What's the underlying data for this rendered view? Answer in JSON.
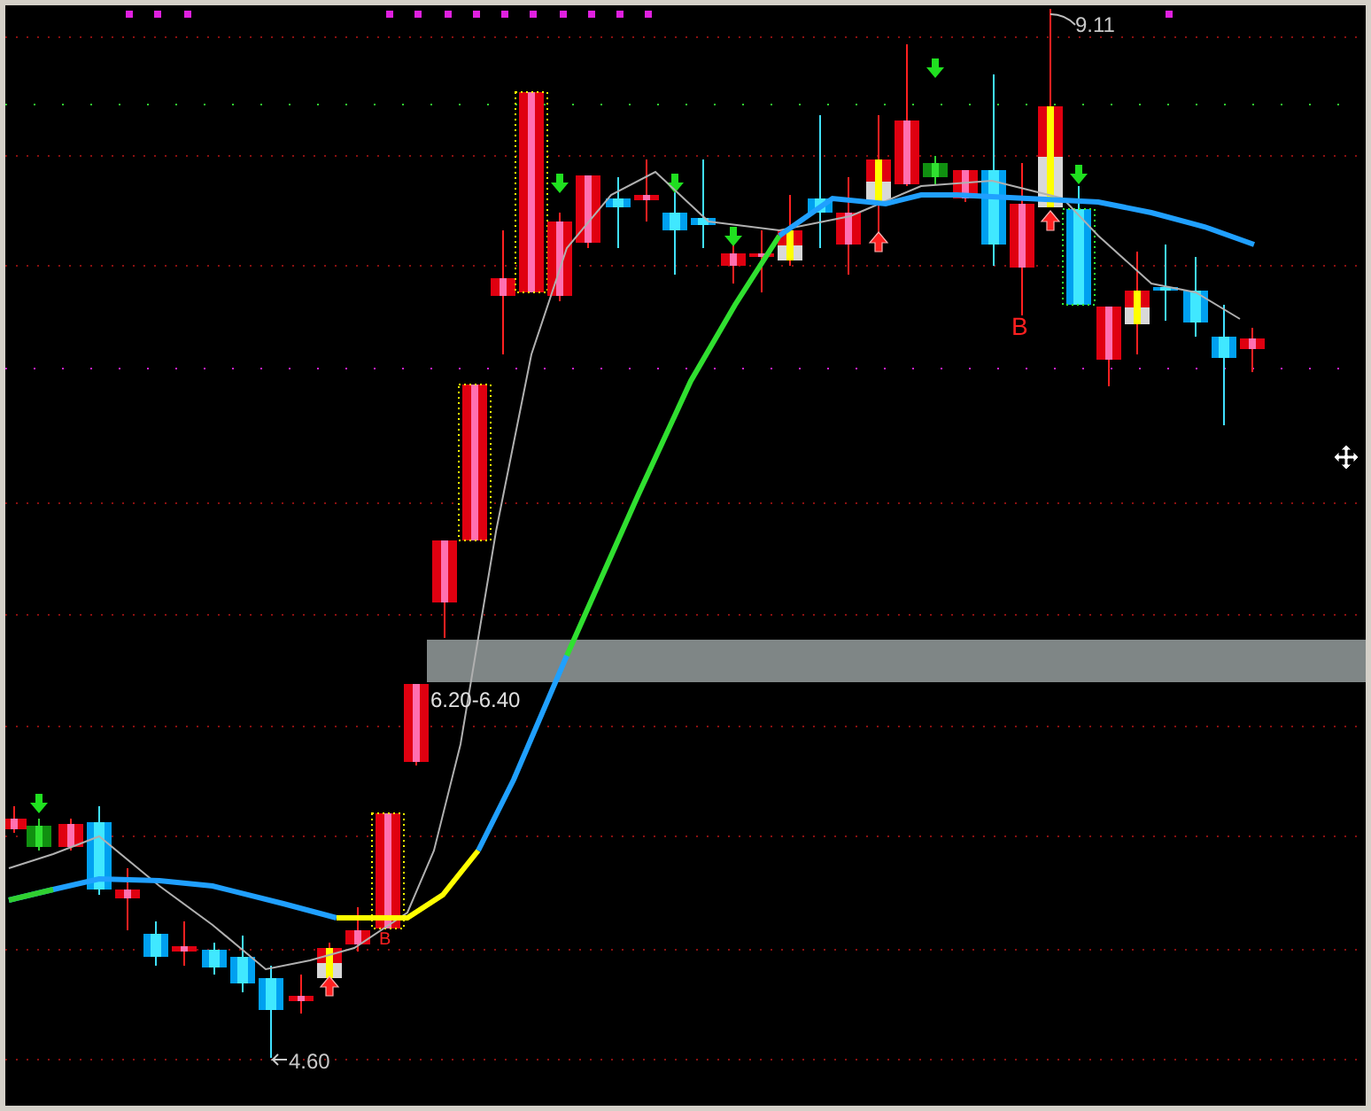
{
  "chart": {
    "high_label": "9.11",
    "zone_label": "6.20-6.40",
    "low_label": "4.60",
    "markers": [
      {
        "text": "B"
      },
      {
        "text": "B"
      }
    ]
  }
}
